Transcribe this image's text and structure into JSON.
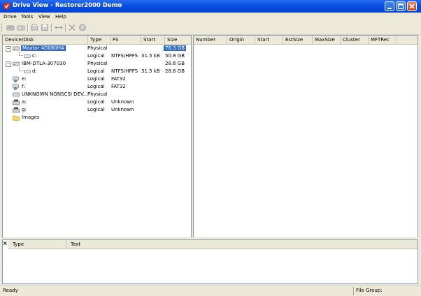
{
  "window": {
    "title": "Drive View - Restorer2000 Demo"
  },
  "menu": [
    "Drive",
    "Tools",
    "View",
    "Help"
  ],
  "toolbar": {
    "buttons": [
      "open-drive-icon",
      "open-image-icon",
      "scan-icon",
      "save-icon",
      "compare-icon",
      "close-icon",
      "help-icon"
    ]
  },
  "tree": {
    "columns": [
      "Device/Disk",
      "Type",
      "FS",
      "Start",
      "Size"
    ],
    "rows": [
      {
        "name": "Maxtor 4D080H4",
        "type": "Physical",
        "fs": "",
        "start": "",
        "size": "76.3 GB",
        "selected": true,
        "icon": "hard-drive-icon"
      },
      {
        "name": "c:",
        "type": "Logical",
        "fs": "NTFS/HPFS",
        "start": "31.5 kB",
        "size": "50.8 GB",
        "icon": "partition-icon"
      },
      {
        "name": "IBM-DTLA-307030",
        "type": "Physical",
        "fs": "",
        "start": "",
        "size": "28.6 GB",
        "icon": "hard-drive-icon"
      },
      {
        "name": "d:",
        "type": "Logical",
        "fs": "NTFS/HPFS",
        "start": "31.5 kB",
        "size": "28.6 GB",
        "icon": "partition-icon"
      },
      {
        "name": "e:",
        "type": "Logical",
        "fs": "FAT32",
        "start": "",
        "size": "",
        "icon": "network-drive-icon"
      },
      {
        "name": "f:",
        "type": "Logical",
        "fs": "FAT32",
        "start": "",
        "size": "",
        "icon": "network-drive-icon"
      },
      {
        "name": "UNKNOWN NONSCSI DEV...",
        "type": "Physical",
        "fs": "",
        "start": "",
        "size": "",
        "icon": "hard-drive-icon"
      },
      {
        "name": "a:",
        "type": "Logical",
        "fs": "Unknown",
        "start": "",
        "size": "",
        "icon": "floppy-drive-icon"
      },
      {
        "name": "g:",
        "type": "Logical",
        "fs": "Unknown",
        "start": "",
        "size": "",
        "icon": "floppy-drive-icon"
      },
      {
        "name": "Images",
        "type": "",
        "fs": "",
        "start": "",
        "size": "",
        "icon": "folder-icon"
      }
    ]
  },
  "details": {
    "columns": [
      "Number",
      "Origin",
      "Start",
      "EstSize",
      "MaxSize",
      "Cluster",
      "MFTRec"
    ]
  },
  "log": {
    "close_glyph": "×",
    "columns": [
      "Type",
      "Text"
    ]
  },
  "status": {
    "left": "Ready",
    "right": "File Group:"
  },
  "colors": {
    "title_bar": "#0a4fe0",
    "selection": "#316ac5"
  }
}
